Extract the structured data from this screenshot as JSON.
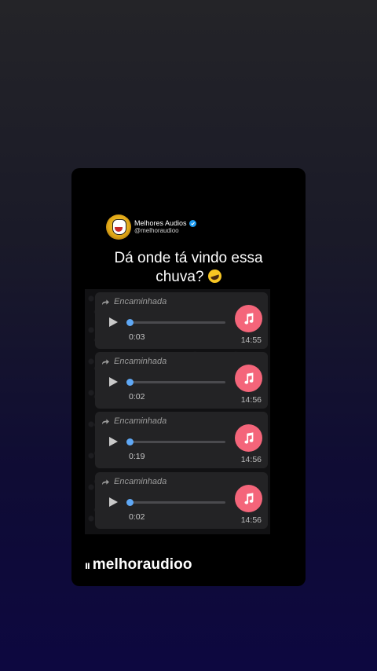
{
  "author": {
    "name": "Melhores Audios",
    "handle": "@melhoraudioo",
    "verified": true
  },
  "headline": {
    "line1": "Dá onde tá vindo essa",
    "line2": "chuva?",
    "emoji": "rolling-on-floor-laughing"
  },
  "messages": [
    {
      "forward_label": "Encaminhada",
      "duration": "0:03",
      "time": "14:55",
      "progress": 0
    },
    {
      "forward_label": "Encaminhada",
      "duration": "0:02",
      "time": "14:56",
      "progress": 0
    },
    {
      "forward_label": "Encaminhada",
      "duration": "0:19",
      "time": "14:56",
      "progress": 0
    },
    {
      "forward_label": "Encaminhada",
      "duration": "0:02",
      "time": "14:56",
      "progress": 0
    }
  ],
  "brand": {
    "logo": "ıı",
    "name": "melhoraudioo"
  },
  "colors": {
    "accent_pink": "#f4657a",
    "progress_blue": "#5fa8f5",
    "verified_blue": "#1d9bf0"
  }
}
